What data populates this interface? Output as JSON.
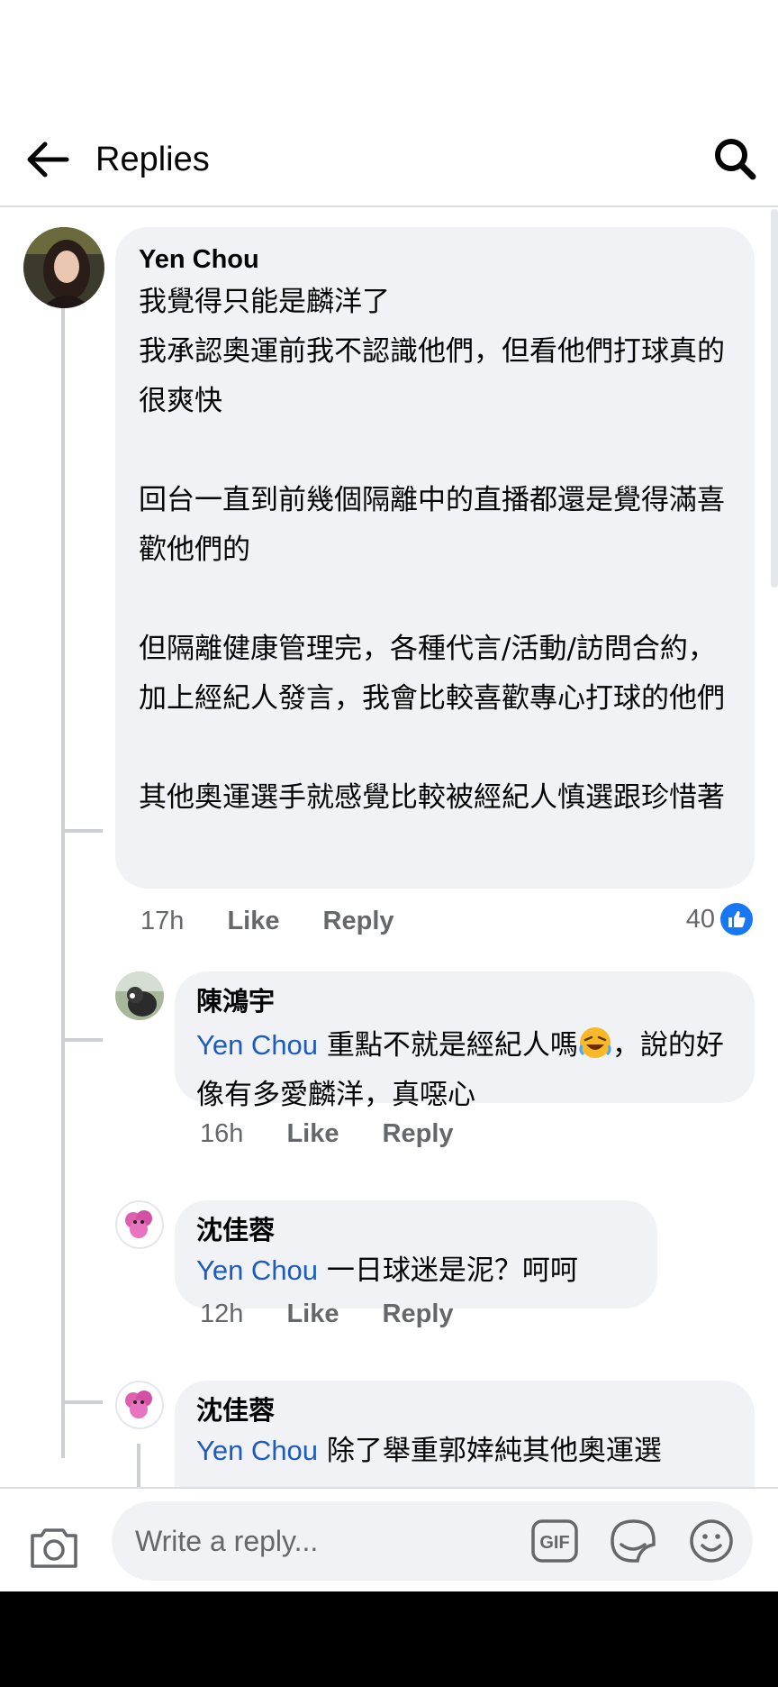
{
  "header": {
    "title": "Replies",
    "back_icon": "arrow-left-icon",
    "search_icon": "search-icon"
  },
  "comment": {
    "author": "Yen Chou",
    "text": "我覺得只能是麟洋了\n我承認奧運前我不認識他們，但看他們打球真的很爽快\n\n回台一直到前幾個隔離中的直播都還是覺得滿喜歡他們的\n\n但隔離健康管理完，各種代言/活動/訪問合約，加上經紀人發言，我會比較喜歡專心打球的他們\n\n其他奧運選手就感覺比較被經紀人慎選跟珍惜著",
    "time": "17h",
    "like_label": "Like",
    "reply_label": "Reply",
    "reaction_count": "40",
    "reaction_icon": "like-reaction-icon"
  },
  "replies": [
    {
      "author": "陳鴻宇",
      "mention": "Yen Chou",
      "text_before_emoji": " 重點不就是經紀人嗎",
      "emoji": "rolling-laughing-emoji",
      "text_after_emoji": "，說的好像有多愛麟洋，真噁心",
      "time": "16h",
      "like_label": "Like",
      "reply_label": "Reply"
    },
    {
      "author": "沈佳蓉",
      "mention": "Yen Chou",
      "text": " 一日球迷是泥？呵呵",
      "time": "12h",
      "like_label": "Like",
      "reply_label": "Reply"
    },
    {
      "author": "沈佳蓉",
      "mention": "Yen Chou",
      "text": " 除了舉重郭婞純其他奧運選"
    }
  ],
  "composer": {
    "placeholder": "Write a reply...",
    "camera_icon": "camera-icon",
    "gif_icon": "gif-icon",
    "sticker_icon": "sticker-icon",
    "emoji_icon": "smiley-icon"
  },
  "colors": {
    "mention": "#1c5cc2",
    "bubble": "#f0f2f5",
    "meta": "#65676b",
    "like_blue": "#1877f2"
  }
}
